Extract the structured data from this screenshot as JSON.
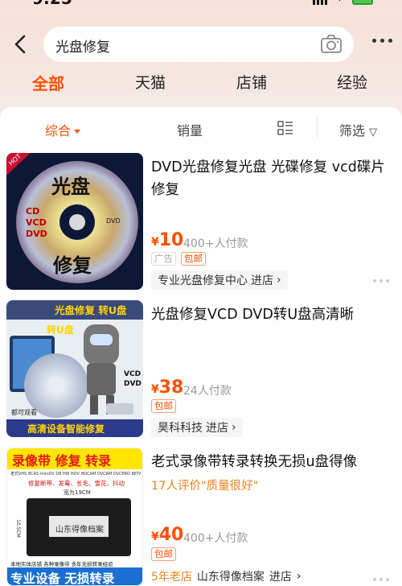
{
  "status": {
    "time": "9:25"
  },
  "search": {
    "query": "光盘修复"
  },
  "tabs": [
    {
      "label": "全部",
      "active": true
    },
    {
      "label": "天猫",
      "active": false
    },
    {
      "label": "店铺",
      "active": false
    },
    {
      "label": "经验",
      "active": false
    }
  ],
  "sort": {
    "comprehensive": "综合",
    "sales": "销量",
    "filter": "筛选"
  },
  "colors": {
    "accent": "#ff5000",
    "review": "#e8841c"
  },
  "products": [
    {
      "title": "DVD光盘修复光盘  光碟修复  vcd碟片修复",
      "currency": "¥",
      "price": "10",
      "paid": "400+人付款",
      "badges": [
        "广告",
        "包邮"
      ],
      "shop": "专业光盘修复中心",
      "shop_link": "进店",
      "image_text": {
        "corner": "HOT",
        "top": "光盘",
        "bottom": "修复",
        "lines": [
          "CD",
          "VCD",
          "DVD"
        ],
        "disc": "DVD"
      }
    },
    {
      "title": "光盘修复VCD DVD转U盘高清晰",
      "currency": "¥",
      "price": "38",
      "paid": "24人付款",
      "badges": [
        "包邮"
      ],
      "shop": "昊科科技",
      "shop_link": "进店",
      "image_text": {
        "banner": "光盘修复  转U盘",
        "sub": "转U盘",
        "tags": [
          "VCD",
          "DVD"
        ],
        "note": "都可观看",
        "footer": "高清设备智能修复"
      }
    },
    {
      "title": "老式录像带转录转换无损u盘得像",
      "currency": "¥",
      "price": "40",
      "paid": "400+人付款",
      "review": "17人评价\"质量很好\"",
      "badges": [
        "包邮"
      ],
      "shop_year": "5年老店",
      "shop": "山东得像档案",
      "shop_link": "进店",
      "image_text": {
        "banner": "录像带 修复 转录",
        "types": "老式VHS 8CAS miniDV D8 Hi8 HDV HDCAM DVCAM DVCPRO BETACAM",
        "repairs": "修复断带、发霉、长毛、雪花、抖动",
        "size": "宽为19CM",
        "side": "10.5CM",
        "label": "山东得像档案",
        "slogan": "本地实体店铺  各种录像带  多年无损转录经验",
        "footer": "专业设备 无损转录"
      }
    }
  ]
}
